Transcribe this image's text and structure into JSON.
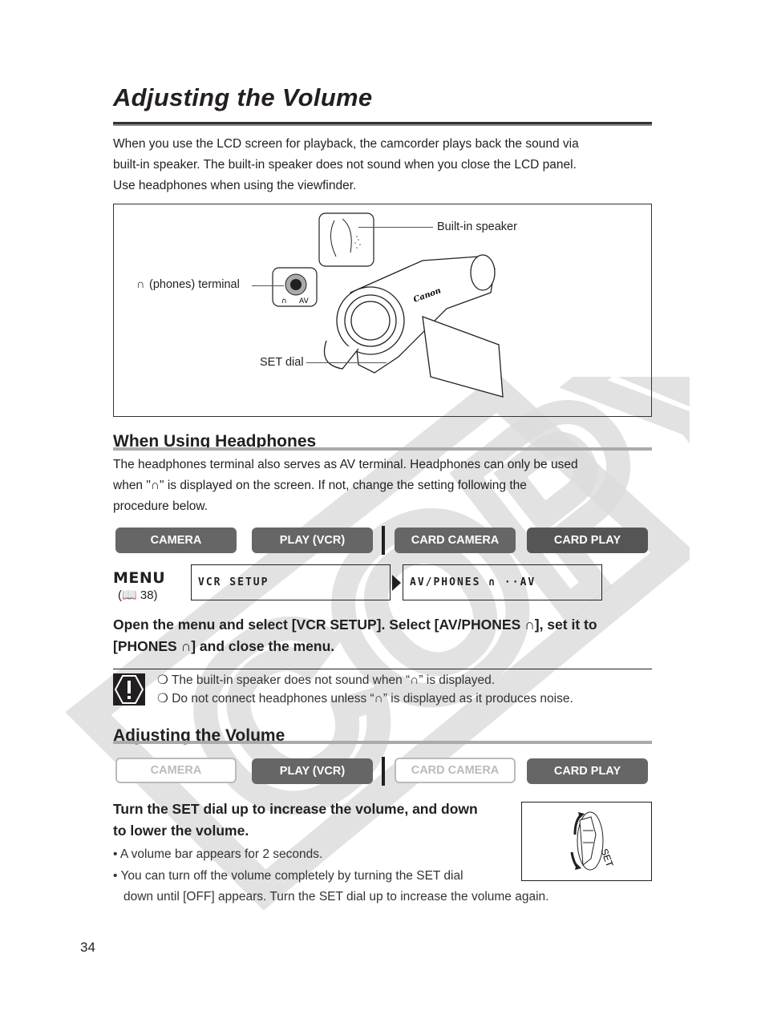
{
  "page": {
    "title": "Adjusting the Volume",
    "intro": [
      "When you use the LCD screen for playback, the camcorder plays back the sound via",
      "built-in speaker. The built-in speaker does not sound when you close the LCD panel.",
      "Use headphones when using the viewfinder."
    ],
    "page_number": "34",
    "watermark": "COPY"
  },
  "figure": {
    "labels": {
      "speaker": "Built-in speaker",
      "phones": "(phones) terminal",
      "set_dial": "SET dial",
      "jack_av": "AV",
      "brand": "Canon"
    }
  },
  "headphones_section": {
    "heading": "When Using Headphones",
    "body": [
      "The headphones terminal also serves as AV terminal. Headphones can only be used",
      "when \"∩\" is displayed on the screen. If not, change the setting following the",
      "procedure below."
    ],
    "modes": [
      {
        "label": "CAMERA",
        "state": "active"
      },
      {
        "label": "PLAY (VCR)",
        "state": "active"
      },
      {
        "label": "CARD CAMERA",
        "state": "active"
      },
      {
        "label": "CARD PLAY",
        "state": "active"
      }
    ],
    "menu": {
      "word": "MENU",
      "ref": "38",
      "step1": "VCR  SETUP",
      "step2": "AV/PHONES ∩ ··AV"
    },
    "instruction": [
      "Open the menu and select [VCR SETUP]. Select [AV/PHONES ∩], set it to",
      "[PHONES ∩] and close the menu."
    ],
    "notes": [
      "The built-in speaker does not sound when “∩” is displayed.",
      "Do not connect headphones unless “∩” is displayed as it produces noise."
    ]
  },
  "volume_section": {
    "heading": "Adjusting the Volume",
    "modes": [
      {
        "label": "CAMERA",
        "state": "inactive"
      },
      {
        "label": "PLAY (VCR)",
        "state": "active"
      },
      {
        "label": "CARD CAMERA",
        "state": "inactive"
      },
      {
        "label": "CARD PLAY",
        "state": "active"
      }
    ],
    "instruction": [
      "Turn the SET dial up to increase the volume, and down",
      "to lower the volume."
    ],
    "bullets": [
      "A volume bar appears for 2 seconds.",
      "You can turn off the volume completely by turning the SET dial",
      "down until [OFF] appears. Turn the SET dial up to increase the volume again."
    ],
    "dial_label": "SET"
  }
}
